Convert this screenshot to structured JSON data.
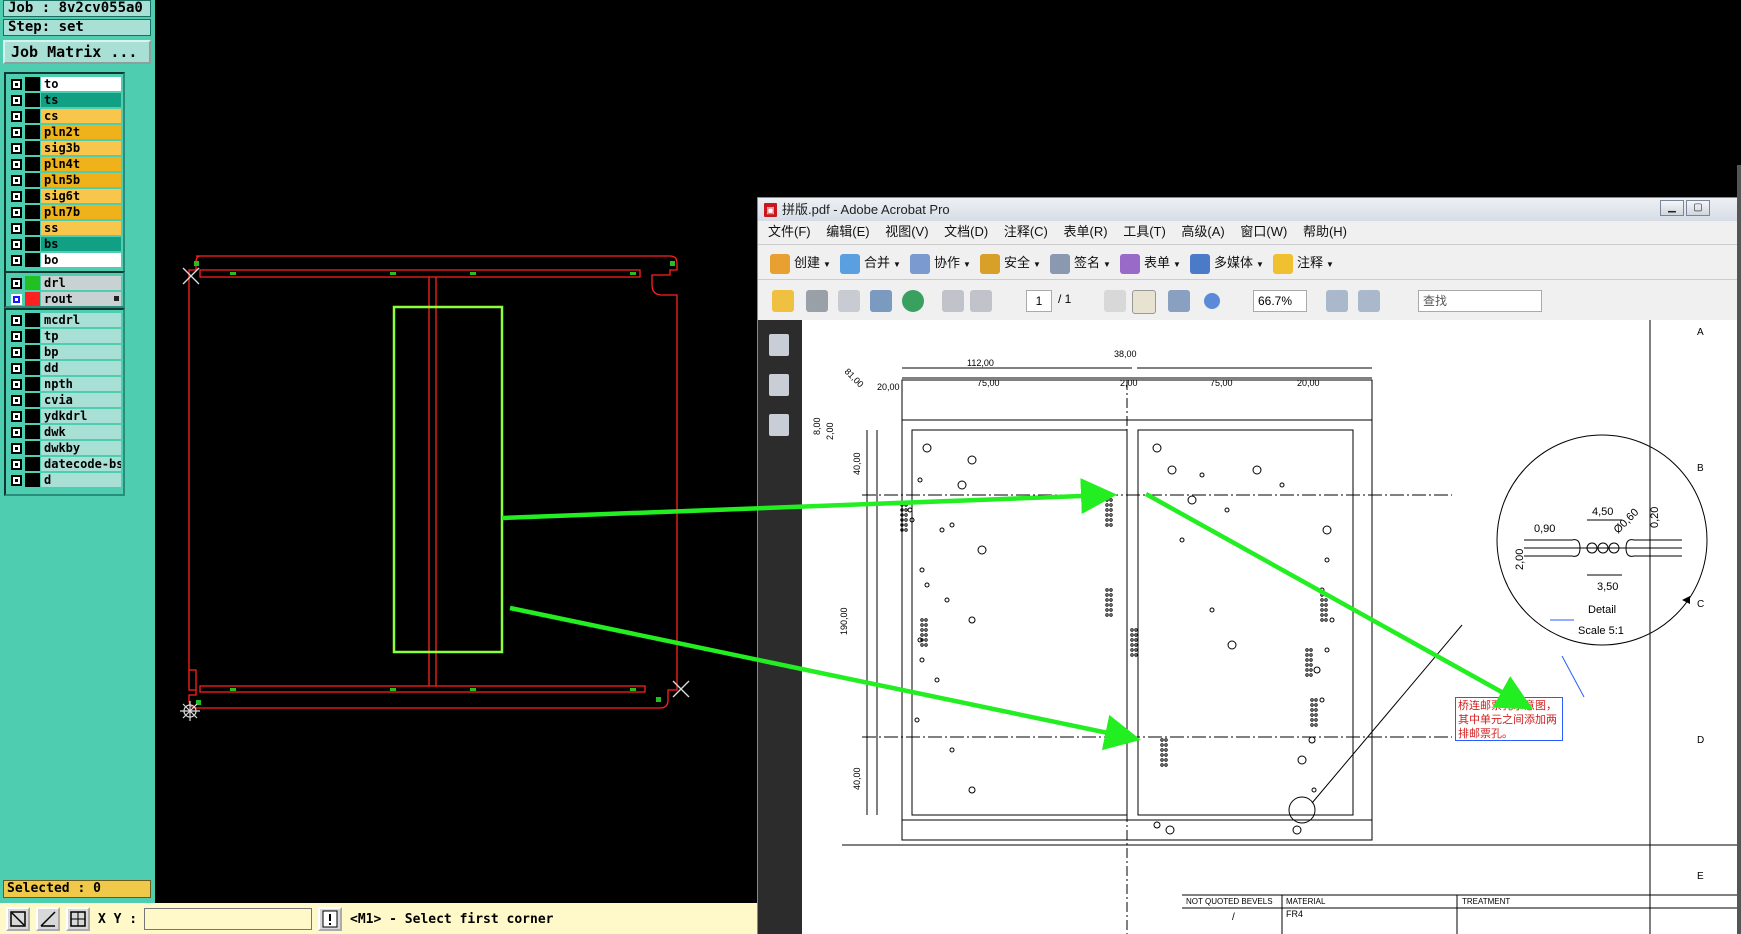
{
  "cam": {
    "job_label": "Job : 8v2cv055a0",
    "step_label": "Step: set",
    "job_matrix_button": "Job Matrix ...",
    "layers_group1": [
      {
        "name": "to",
        "color": "#ffffff"
      },
      {
        "name": "ts",
        "color": "#12a085"
      },
      {
        "name": "cs",
        "color": "#f7c64a"
      },
      {
        "name": "pln2t",
        "color": "#f0b21a"
      },
      {
        "name": "sig3b",
        "color": "#f7c64a"
      },
      {
        "name": "pln4t",
        "color": "#f0b21a"
      },
      {
        "name": "pln5b",
        "color": "#f0b21a"
      },
      {
        "name": "sig6t",
        "color": "#f7c64a"
      },
      {
        "name": "pln7b",
        "color": "#f0b21a"
      },
      {
        "name": "ss",
        "color": "#f7c64a"
      },
      {
        "name": "bs",
        "color": "#12a085"
      },
      {
        "name": "bo",
        "color": "#ffffff"
      }
    ],
    "layers_group2": [
      {
        "name": "drl",
        "color": "#c8d2d2",
        "swatch": "#22c022",
        "active": false
      },
      {
        "name": "rout",
        "color": "#c8d2d2",
        "swatch": "#ff2020",
        "active": true
      }
    ],
    "layers_group3": [
      {
        "name": "mcdrl"
      },
      {
        "name": "tp"
      },
      {
        "name": "bp"
      },
      {
        "name": "dd"
      },
      {
        "name": "npth"
      },
      {
        "name": "cvia"
      },
      {
        "name": "ydkdrl"
      },
      {
        "name": "dwk"
      },
      {
        "name": "dwkby"
      },
      {
        "name": "datecode-bs"
      },
      {
        "name": "d"
      }
    ],
    "selected_label": "Selected : 0",
    "xy_label": "X Y :",
    "xy_value": "",
    "prompt": "<M1> - Select first corner",
    "colors": {
      "panel": "#4ecdb0",
      "outline": "#ff2020",
      "highlight": "#8cff3a",
      "arrow": "#22ee22"
    }
  },
  "acrobat": {
    "title": "拼版.pdf - Adobe Acrobat Pro",
    "menu": [
      "文件(F)",
      "编辑(E)",
      "视图(V)",
      "文档(D)",
      "注释(C)",
      "表单(R)",
      "工具(T)",
      "高级(A)",
      "窗口(W)",
      "帮助(H)"
    ],
    "toolbar": [
      {
        "label": "创建",
        "icon": "create-icon"
      },
      {
        "label": "合并",
        "icon": "combine-icon"
      },
      {
        "label": "协作",
        "icon": "collaborate-icon"
      },
      {
        "label": "安全",
        "icon": "lock-icon"
      },
      {
        "label": "签名",
        "icon": "pen-icon"
      },
      {
        "label": "表单",
        "icon": "form-icon"
      },
      {
        "label": "多媒体",
        "icon": "multimedia-icon"
      },
      {
        "label": "注释",
        "icon": "comment-icon"
      }
    ],
    "page_current": "1",
    "page_total": "/ 1",
    "zoom": "66.7%",
    "find_placeholder": "查找",
    "drawing": {
      "dims_top": [
        "112,00",
        "20,00",
        "75,00",
        "38,00",
        "2,00",
        "75,00",
        "20,00"
      ],
      "dims_left": [
        "8,00",
        "2,00",
        "40,00",
        "190,00",
        "40,00"
      ],
      "dim_diag": "81,00",
      "detail": {
        "w1": "4,50",
        "w2": "0,90",
        "dia": "Ø0,60",
        "w3": "0,20",
        "h": "2,00",
        "w4": "3,50",
        "label": "Detail",
        "scale": "Scale  5:1"
      },
      "ruler": [
        "A",
        "B",
        "C",
        "D",
        "E"
      ],
      "title_block": {
        "bevels_hdr": "NOT QUOTED BEVELS",
        "bevels_val": "/",
        "material_hdr": "MATERIAL",
        "material_val": "FR4",
        "treatment_hdr": "TREATMENT"
      },
      "callout": "桥连邮票孔示意图，其中单元之间添加两排邮票孔。"
    }
  }
}
